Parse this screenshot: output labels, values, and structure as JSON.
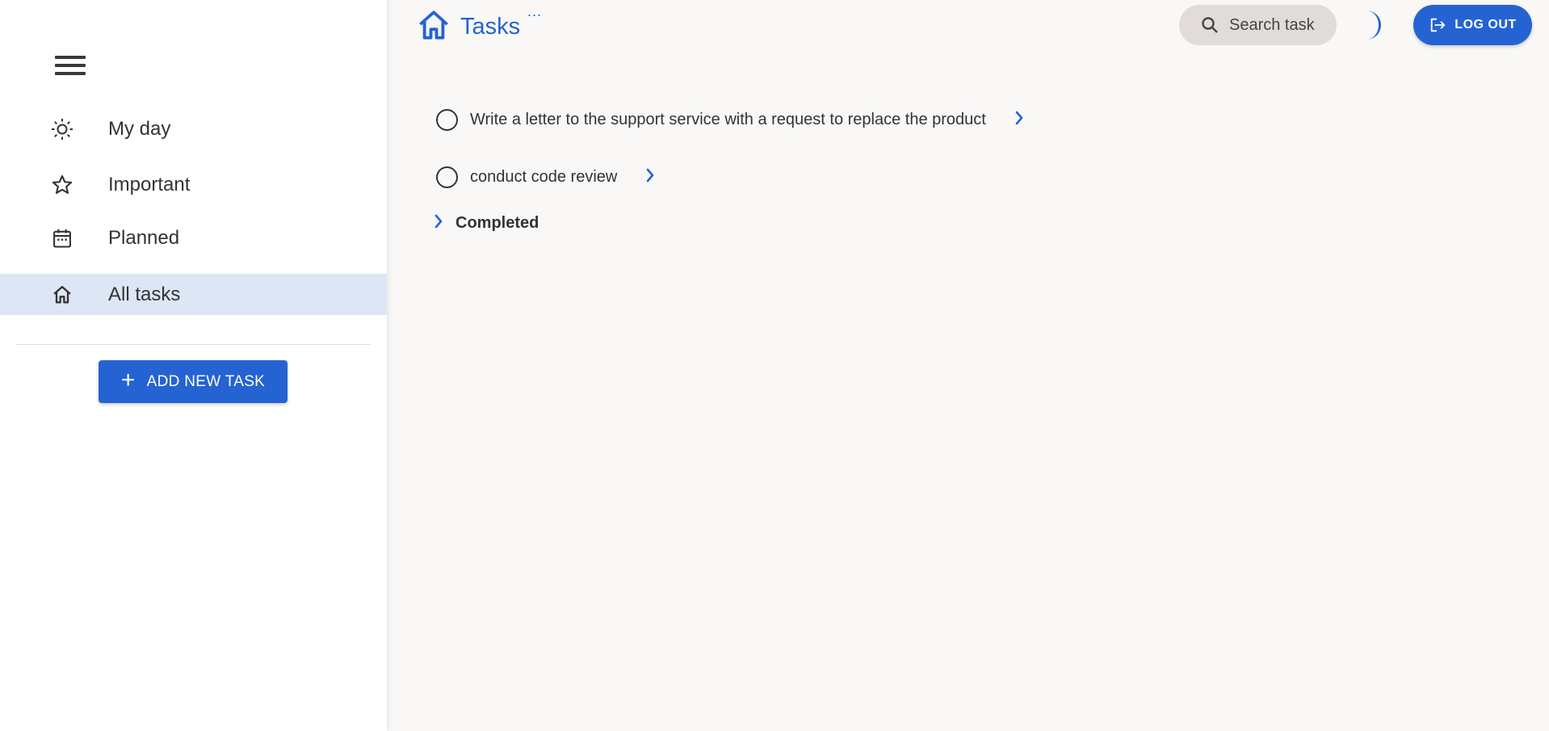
{
  "header": {
    "title": "Tasks",
    "more_label": "...",
    "search_placeholder": "Search task",
    "logout_label": "LOG OUT"
  },
  "sidebar": {
    "items": [
      {
        "label": "My day",
        "icon": "sun-icon"
      },
      {
        "label": "Important",
        "icon": "star-icon"
      },
      {
        "label": "Planned",
        "icon": "calendar-icon"
      },
      {
        "label": "All tasks",
        "icon": "home-icon",
        "active": true
      }
    ],
    "add_button_label": "ADD NEW TASK"
  },
  "tasks": [
    {
      "text": "Write a letter to the support service with a request to replace the product"
    },
    {
      "text": "conduct code review"
    }
  ],
  "completed_label": "Completed",
  "colors": {
    "accent": "#2563d3",
    "active_nav_bg": "#dde6f5",
    "search_bg": "#e1dcd9",
    "main_bg": "#f9f8f7"
  }
}
